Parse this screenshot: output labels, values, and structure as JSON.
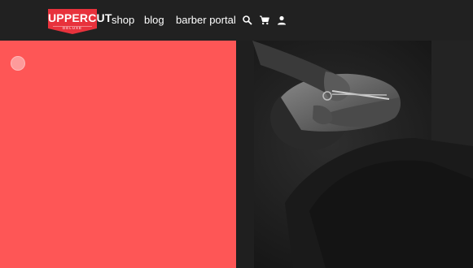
{
  "brand": {
    "name": "UPPERCUT",
    "tagline": "DELUXE",
    "color": "#e8323c"
  },
  "nav": {
    "links": [
      {
        "label": "shop"
      },
      {
        "label": "blog"
      },
      {
        "label": "barber portal"
      }
    ],
    "icons": [
      "search-icon",
      "cart-icon",
      "account-icon"
    ]
  },
  "hero": {
    "left_color": "#fe5656",
    "image": "grayscale photo of a barber trimming a customer's beard with scissors"
  },
  "colors": {
    "header_bg": "#212121",
    "text": "#ffffff"
  }
}
